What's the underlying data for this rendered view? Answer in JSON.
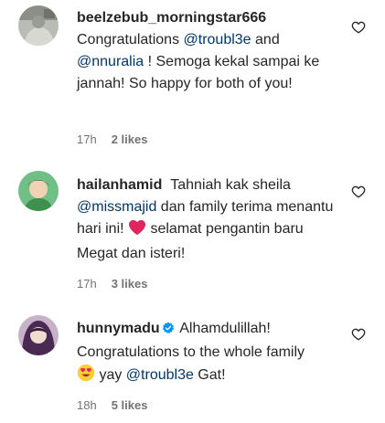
{
  "comments": [
    {
      "username": "beelzebub_morningstar666",
      "verified": false,
      "text_1": "Congratulations ",
      "mention_1": "@troubl3e",
      "text_2": " and",
      "mention_2": "@nnuralia",
      "text_3": " ! Semoga kekal sampai ke jannah! So happy for both of you!",
      "time": "17h",
      "likes": "2 likes",
      "avatar_icon": "avatar-photo"
    },
    {
      "username": "hailanhamid",
      "verified": false,
      "text_1": "Tahniah kak sheila",
      "mention_1": "@missmajid",
      "text_2": " dan family terima menantu hari ini!",
      "emoji_1": "red-heart-emoji",
      "text_3": " selamat pengantin baru Megat dan isteri!",
      "time": "17h",
      "likes": "3 likes",
      "avatar_icon": "avatar-photo"
    },
    {
      "username": "hunnymadu",
      "verified": true,
      "text_1": "Alhamdulillah! Congratulations to the whole family",
      "emoji_1": "heart-eyes-emoji",
      "text_2": " yay ",
      "mention_1": "@troubl3e",
      "text_3": " Gat!",
      "time": "18h",
      "likes": "5 likes",
      "avatar_icon": "avatar-photo"
    }
  ],
  "colors": {
    "text": "#262626",
    "mention": "#00376b",
    "meta": "#737373",
    "verified": "#0095f6",
    "heart_emoji": "#e0245e"
  },
  "icons": {
    "like": "heart-outline-icon",
    "verified": "verified-badge-icon"
  }
}
